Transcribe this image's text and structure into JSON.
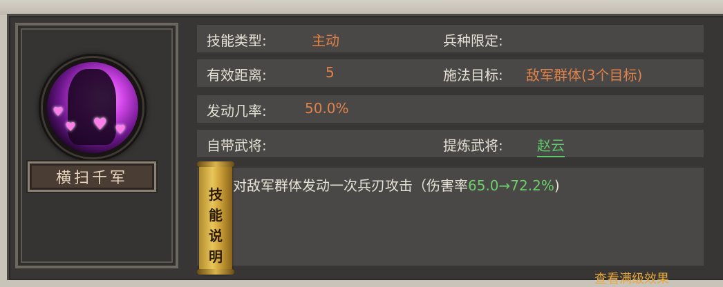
{
  "skill": {
    "name": "横扫千军",
    "type_label": "技能类型:",
    "type_value": "主动",
    "troop_label": "兵种限定:",
    "range_label": "有效距离:",
    "range_value": "5",
    "target_label": "施法目标:",
    "target_value": "敌军群体(3个目标)",
    "chance_label": "发动几率:",
    "chance_value": "50.0%",
    "self_general_label": "自带武将:",
    "extract_label": "提炼武将:",
    "extract_value": "赵云",
    "desc_prefix": "对敌军群体发动一次兵刃攻击（伤害率",
    "desc_number": "65.0→72.2%",
    "desc_suffix": ")",
    "scroll_chars": [
      "技",
      "能",
      "说",
      "明"
    ],
    "footer_hint": "查看满级效果"
  },
  "colors": {
    "value_orange": "#e0824a",
    "value_green": "#5fc86a",
    "panel_bg": "#373634",
    "row_bg": "#4a4846"
  },
  "icons": {
    "avatar": "skill-portrait-icon",
    "scroll": "scroll-icon"
  }
}
